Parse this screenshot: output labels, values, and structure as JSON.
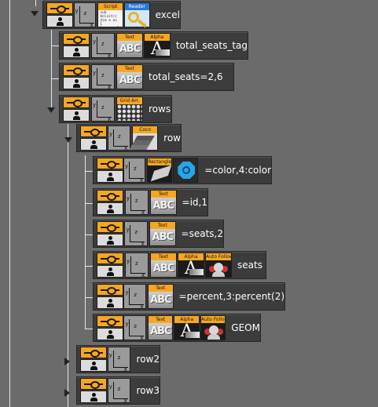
{
  "tree": {
    "nodes": [
      {
        "id": "excel",
        "label": "excel",
        "plugins": [
          {
            "kind": "script",
            "tag": "Script",
            "lines": [
              "sub Onlnit()",
              "dim a as I",
              "RegisterPa",
              "end sub"
            ]
          },
          {
            "kind": "reader",
            "tag": "Reader"
          }
        ]
      },
      {
        "id": "total_seats_tag",
        "label": "total_seats_tag",
        "plugins": [
          {
            "kind": "abc",
            "tag": "Text",
            "glyph": "ABC"
          },
          {
            "kind": "alpha",
            "tag": "Alpha",
            "glyph": "A"
          }
        ]
      },
      {
        "id": "total_seats",
        "label": "total_seats=2,6",
        "plugins": [
          {
            "kind": "abc",
            "tag": "Text",
            "glyph": "ABC"
          }
        ]
      },
      {
        "id": "rows",
        "label": "rows",
        "plugins": [
          {
            "kind": "grid",
            "tag": "Grid Arr."
          }
        ]
      },
      {
        "id": "row",
        "label": "row",
        "plugins": [
          {
            "kind": "coco",
            "tag": "Coco"
          }
        ]
      },
      {
        "id": "color",
        "label": "=color,4:color",
        "plugins": [
          {
            "kind": "rect",
            "tag": "Rectangle"
          },
          {
            "kind": "hex",
            "tag": ""
          }
        ]
      },
      {
        "id": "id",
        "label": "=id,1",
        "plugins": [
          {
            "kind": "abc",
            "tag": "Text",
            "glyph": "ABC"
          }
        ]
      },
      {
        "id": "seats_num",
        "label": "=seats,2",
        "plugins": [
          {
            "kind": "abc",
            "tag": "Text",
            "glyph": "ABC"
          }
        ]
      },
      {
        "id": "seats",
        "label": "seats",
        "plugins": [
          {
            "kind": "abc",
            "tag": "Text",
            "glyph": "ABC"
          },
          {
            "kind": "alpha",
            "tag": "Alpha",
            "glyph": "A"
          },
          {
            "kind": "follow",
            "tag": "Auto Follow"
          }
        ]
      },
      {
        "id": "percent",
        "label": "=percent,3:percent(2)",
        "plugins": [
          {
            "kind": "abc",
            "tag": "Text",
            "glyph": "ABC"
          }
        ]
      },
      {
        "id": "geom",
        "label": "GEOM",
        "plugins": [
          {
            "kind": "abc",
            "tag": "Text",
            "glyph": "ABC"
          },
          {
            "kind": "alpha",
            "tag": "Alpha",
            "glyph": "A"
          },
          {
            "kind": "follow",
            "tag": "Auto Follow"
          }
        ]
      },
      {
        "id": "row2",
        "label": "row2",
        "plugins": []
      },
      {
        "id": "row3",
        "label": "row3",
        "plugins": []
      }
    ]
  },
  "axis_labels": {
    "y": "y",
    "z": "z",
    "x": "x"
  },
  "colors": {
    "background": "#6b6b6b",
    "node": "#3c3c3c",
    "toggle": "#f5a623",
    "plugin_tag": "#f5a623",
    "reader_tag": "#2a78d6",
    "connector": "#e6e6e6"
  }
}
